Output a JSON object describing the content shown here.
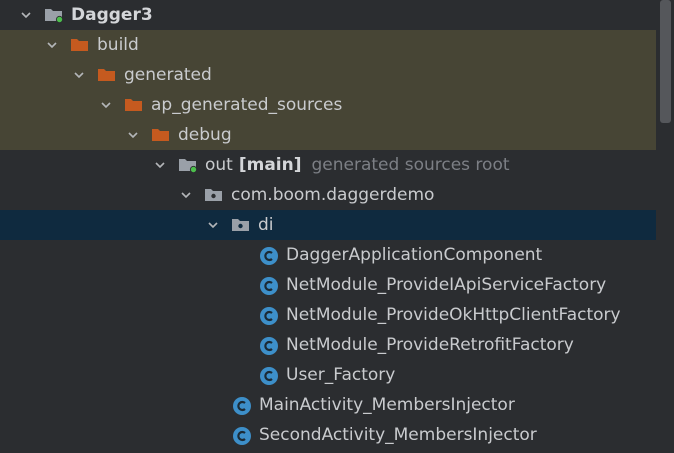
{
  "tree": {
    "project": {
      "label": "Dagger3",
      "icon": "project-folder-icon"
    },
    "build": {
      "label": "build",
      "icon": "excluded-folder-icon"
    },
    "generated": {
      "label": "generated",
      "icon": "excluded-folder-icon"
    },
    "ap_generated_sources": {
      "label": "ap_generated_sources",
      "icon": "excluded-folder-icon"
    },
    "debug": {
      "label": "debug",
      "icon": "excluded-folder-icon"
    },
    "out": {
      "label": "out",
      "suffix": "[main]",
      "hint": "generated sources root",
      "icon": "generated-root-folder-icon"
    },
    "package": {
      "label": "com.boom.daggerdemo",
      "icon": "package-icon"
    },
    "di": {
      "label": "di",
      "icon": "package-icon"
    },
    "classes": [
      {
        "label": "DaggerApplicationComponent"
      },
      {
        "label": "NetModule_ProvideIApiServiceFactory"
      },
      {
        "label": "NetModule_ProvideOkHttpClientFactory"
      },
      {
        "label": "NetModule_ProvideRetrofitFactory"
      },
      {
        "label": "User_Factory"
      }
    ],
    "package_classes": [
      {
        "label": "MainActivity_MembersInjector"
      },
      {
        "label": "SecondActivity_MembersInjector"
      }
    ]
  },
  "colors": {
    "background": "#2b2d30",
    "excluded_row": "#474535",
    "selected_row": "#0f2a3f",
    "excluded_folder": "#c55a1f",
    "class_icon": "#3d8fc9",
    "source_root_dot": "#4cbf4c"
  }
}
